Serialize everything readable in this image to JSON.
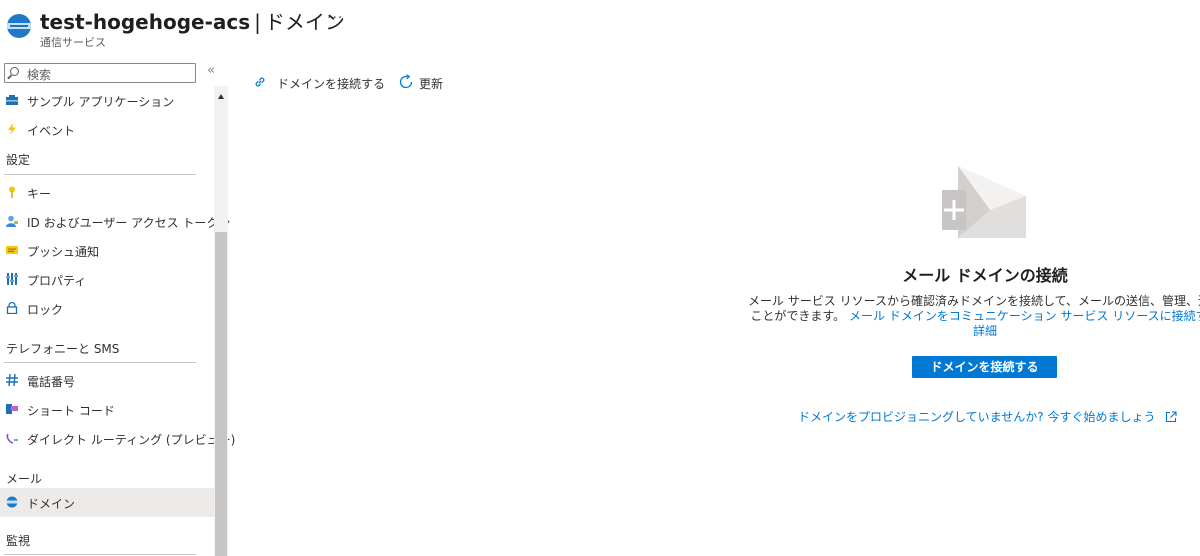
{
  "header": {
    "resource_name": "test-hogehoge-acs",
    "separator": "|",
    "page_name": "ドメイン",
    "subtitle": "通信サービス",
    "more": "···"
  },
  "sidebar": {
    "search_placeholder": "検索",
    "collapse": "«",
    "items_top": [
      {
        "label": "サンプル アプリケーション",
        "icon": "toolbox-icon"
      },
      {
        "label": "イベント",
        "icon": "lightning-icon"
      }
    ],
    "sections": [
      {
        "title": "設定",
        "items": [
          {
            "label": "キー",
            "icon": "key-icon"
          },
          {
            "label": "ID およびユーザー アクセス トークン",
            "icon": "identity-icon"
          },
          {
            "label": "プッシュ通知",
            "icon": "notification-icon"
          },
          {
            "label": "プロパティ",
            "icon": "properties-icon"
          },
          {
            "label": "ロック",
            "icon": "lock-icon"
          }
        ]
      },
      {
        "title": "テレフォニーと SMS",
        "items": [
          {
            "label": "電話番号",
            "icon": "hash-icon"
          },
          {
            "label": "ショート コード",
            "icon": "short-code-icon"
          },
          {
            "label": "ダイレクト ルーティング (プレビュー)",
            "icon": "direct-routing-icon"
          }
        ]
      },
      {
        "title": "メール",
        "items": [
          {
            "label": "ドメイン",
            "icon": "domain-icon",
            "selected": true
          }
        ]
      },
      {
        "title": "監視",
        "items": []
      }
    ]
  },
  "toolbar": {
    "connect_label": "ドメインを接続する",
    "refresh_label": "更新"
  },
  "empty_state": {
    "heading": "メール ドメインの接続",
    "desc_line1": "メール サービス リソースから確認済みドメインを接続して、メールの送信、管理、追跡",
    "desc_line2_text": "ことができます。",
    "desc_link": "メール ドメインをコミュニケーション サービス リソースに接続する",
    "desc_link2": "詳細",
    "primary_button": "ドメインを接続する",
    "provision_link": "ドメインをプロビジョニングしていませんか? 今すぐ始めましょう"
  },
  "colors": {
    "accent": "#0078d4",
    "selected_bg": "#edebe9"
  }
}
